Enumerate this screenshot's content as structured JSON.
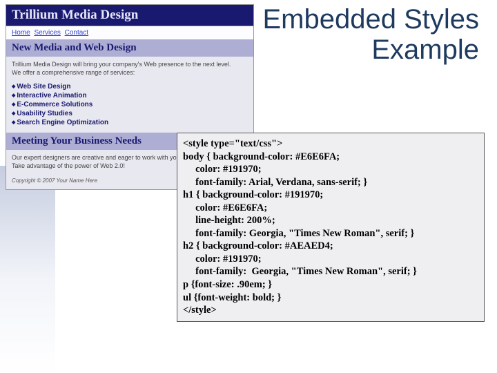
{
  "slide": {
    "title_line1": "Embedded Styles",
    "title_line2": "Example"
  },
  "mock": {
    "site_title": "Trillium Media Design",
    "nav": {
      "home": "Home",
      "services": "Services",
      "contact": "Contact"
    },
    "h2a": "New Media and Web Design",
    "intro1": "Trillium Media Design will bring your company's Web presence to the next level.",
    "intro2": "We offer a comprehensive range of services:",
    "services": [
      "Web Site Design",
      "Interactive Animation",
      "E-Commerce Solutions",
      "Usability Studies",
      "Search Engine Optimization"
    ],
    "h2b": "Meeting Your Business Needs",
    "body2a": "Our expert designers are creative and eager to work with you.",
    "body2b": "Take advantage of the power of Web 2.0!",
    "copyright": "Copyright © 2007 Your Name Here"
  },
  "code": {
    "l01": "<style type=\"text/css\">",
    "l02": "body { background-color: #E6E6FA;",
    "l03": "     color: #191970;",
    "l04": "     font-family: Arial, Verdana, sans-serif; }",
    "l05": "h1 { background-color: #191970;",
    "l06": "     color: #E6E6FA;",
    "l07": "     line-height: 200%;",
    "l08": "     font-family: Georgia, \"Times New Roman\", serif; }",
    "l09": "h2 { background-color: #AEAED4;",
    "l10": "     color: #191970;",
    "l11": "     font-family:  Georgia, \"Times New Roman\", serif; }",
    "l12": "p {font-size: .90em; }",
    "l13": "ul {font-weight: bold; }",
    "l14": "</style>"
  }
}
